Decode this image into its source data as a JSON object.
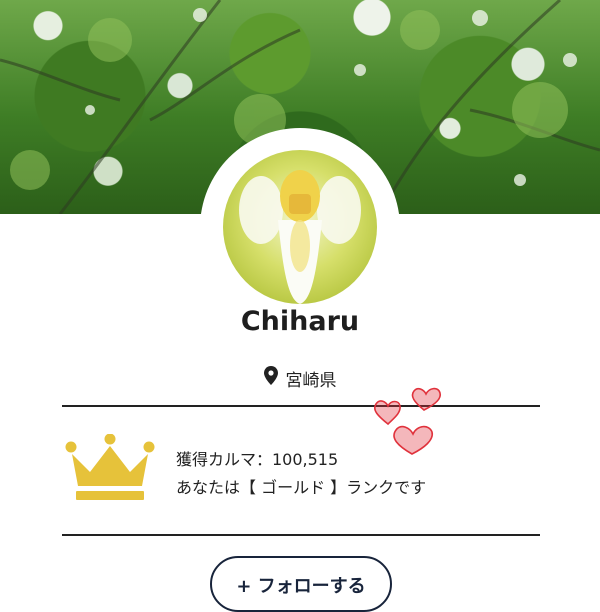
{
  "profile": {
    "name": "Chiharu",
    "location": "宮崎県"
  },
  "karma": {
    "line1": "獲得カルマ：100,515",
    "line2": "あなたは【 ゴールド 】ランクです",
    "rank_color": "#e6c23a"
  },
  "actions": {
    "follow_label": "+ フォローする"
  },
  "icons": {
    "location": "map-pin-icon",
    "rank": "crown-icon",
    "decoration": "hearts-icon"
  },
  "colors": {
    "heart": "#e0323c",
    "button_border": "#18243b"
  }
}
